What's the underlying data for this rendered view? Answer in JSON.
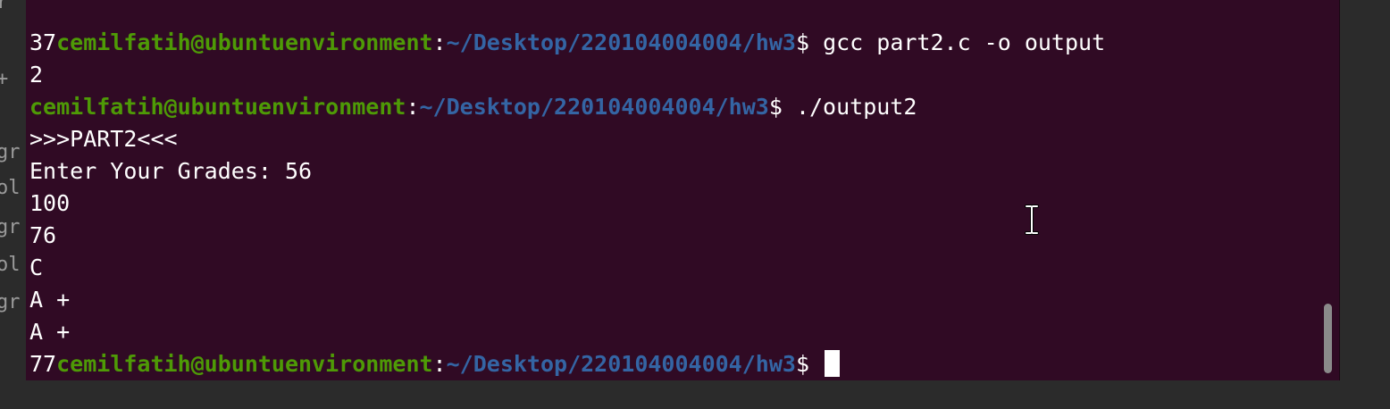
{
  "left_fragments": [
    "r",
    "",
    "+",
    "",
    "gr",
    "ol",
    "gr",
    "ol",
    "gr"
  ],
  "terminal": {
    "lines": [
      {
        "prefix": "37",
        "user": "cemilfatih@ubuntuenvironment",
        "sep": ":",
        "path": "~/Desktop/220104004004/hw3",
        "prompt": "$ ",
        "command": "gcc part2.c -o output"
      },
      {
        "text": "2"
      },
      {
        "prefix": "",
        "user": "cemilfatih@ubuntuenvironment",
        "sep": ":",
        "path": "~/Desktop/220104004004/hw3",
        "prompt": "$ ",
        "command": "./output2"
      },
      {
        "text": ">>>PART2<<<"
      },
      {
        "text": "Enter Your Grades: 56"
      },
      {
        "text": "100"
      },
      {
        "text": "76"
      },
      {
        "text": "C"
      },
      {
        "text": "A +"
      },
      {
        "text": "A +"
      },
      {
        "prefix": "77",
        "user": "cemilfatih@ubuntuenvironment",
        "sep": ":",
        "path": "~/Desktop/220104004004/hw3",
        "prompt": "$ ",
        "command": ""
      }
    ]
  },
  "icons": {
    "cursor": "text-cursor-block",
    "pointer": "i-beam-icon",
    "scrollbar": "scrollbar-thumb"
  },
  "colors": {
    "background": "#300a24",
    "user": "#4e9a06",
    "path": "#3465a4",
    "text": "#ffffff"
  }
}
